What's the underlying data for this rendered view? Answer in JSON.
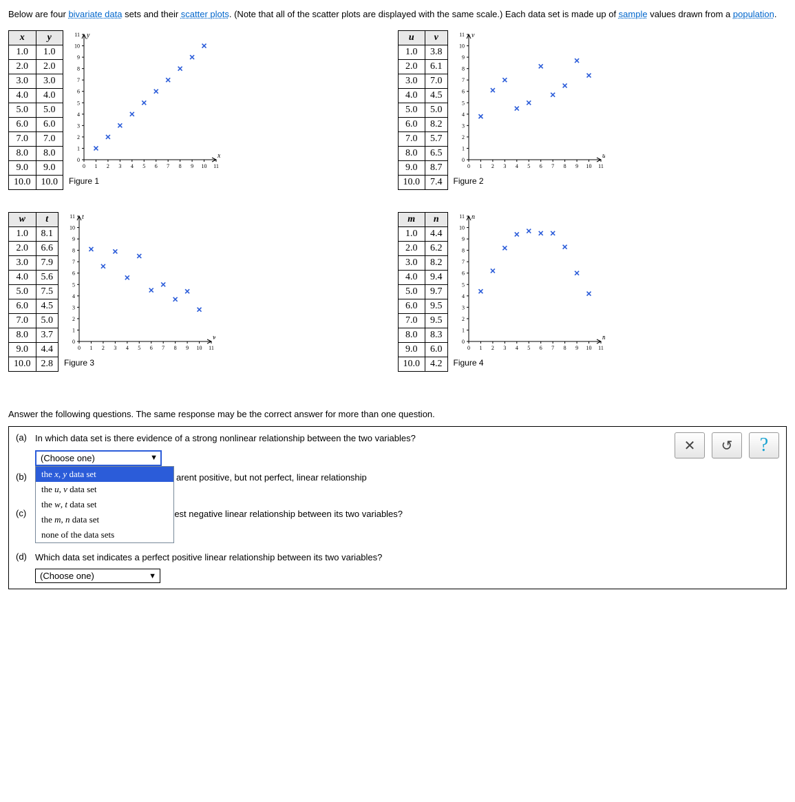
{
  "intro": {
    "pre": "Below are four ",
    "t1": "bivariate data",
    "mid1": " sets and their ",
    "t2": "scatter plots",
    "mid2": ". (Note that all of the scatter plots are displayed with the same scale.) Each data set is made up of ",
    "t3": "sample",
    "mid3": " values drawn from a ",
    "t4": "population",
    "post": "."
  },
  "axis": {
    "min": 0,
    "max": 11,
    "ticks": [
      0,
      1,
      2,
      3,
      4,
      5,
      6,
      7,
      8,
      9,
      10,
      11
    ]
  },
  "datasets": [
    {
      "id": "xy",
      "cols": [
        "x",
        "y"
      ],
      "caption": "Figure 1",
      "xAxis": "x",
      "yAxis": "y",
      "rows": [
        [
          "1.0",
          "1.0"
        ],
        [
          "2.0",
          "2.0"
        ],
        [
          "3.0",
          "3.0"
        ],
        [
          "4.0",
          "4.0"
        ],
        [
          "5.0",
          "5.0"
        ],
        [
          "6.0",
          "6.0"
        ],
        [
          "7.0",
          "7.0"
        ],
        [
          "8.0",
          "8.0"
        ],
        [
          "9.0",
          "9.0"
        ],
        [
          "10.0",
          "10.0"
        ]
      ]
    },
    {
      "id": "uv",
      "cols": [
        "u",
        "v"
      ],
      "caption": "Figure 2",
      "xAxis": "u",
      "yAxis": "v",
      "rows": [
        [
          "1.0",
          "3.8"
        ],
        [
          "2.0",
          "6.1"
        ],
        [
          "3.0",
          "7.0"
        ],
        [
          "4.0",
          "4.5"
        ],
        [
          "5.0",
          "5.0"
        ],
        [
          "6.0",
          "8.2"
        ],
        [
          "7.0",
          "5.7"
        ],
        [
          "8.0",
          "6.5"
        ],
        [
          "9.0",
          "8.7"
        ],
        [
          "10.0",
          "7.4"
        ]
      ]
    },
    {
      "id": "wt",
      "cols": [
        "w",
        "t"
      ],
      "caption": "Figure 3",
      "xAxis": "w",
      "yAxis": "t",
      "rows": [
        [
          "1.0",
          "8.1"
        ],
        [
          "2.0",
          "6.6"
        ],
        [
          "3.0",
          "7.9"
        ],
        [
          "4.0",
          "5.6"
        ],
        [
          "5.0",
          "7.5"
        ],
        [
          "6.0",
          "4.5"
        ],
        [
          "7.0",
          "5.0"
        ],
        [
          "8.0",
          "3.7"
        ],
        [
          "9.0",
          "4.4"
        ],
        [
          "10.0",
          "2.8"
        ]
      ]
    },
    {
      "id": "mn",
      "cols": [
        "m",
        "n"
      ],
      "caption": "Figure 4",
      "xAxis": "m",
      "yAxis": "n",
      "rows": [
        [
          "1.0",
          "4.4"
        ],
        [
          "2.0",
          "6.2"
        ],
        [
          "3.0",
          "8.2"
        ],
        [
          "4.0",
          "9.4"
        ],
        [
          "5.0",
          "9.7"
        ],
        [
          "6.0",
          "9.5"
        ],
        [
          "7.0",
          "9.5"
        ],
        [
          "8.0",
          "8.3"
        ],
        [
          "9.0",
          "6.0"
        ],
        [
          "10.0",
          "4.2"
        ]
      ]
    }
  ],
  "chart_data": [
    {
      "type": "scatter",
      "title": "Figure 1",
      "xlabel": "x",
      "ylabel": "y",
      "xlim": [
        0,
        11
      ],
      "ylim": [
        0,
        11
      ],
      "x": [
        1,
        2,
        3,
        4,
        5,
        6,
        7,
        8,
        9,
        10
      ],
      "y": [
        1,
        2,
        3,
        4,
        5,
        6,
        7,
        8,
        9,
        10
      ]
    },
    {
      "type": "scatter",
      "title": "Figure 2",
      "xlabel": "u",
      "ylabel": "v",
      "xlim": [
        0,
        11
      ],
      "ylim": [
        0,
        11
      ],
      "x": [
        1,
        2,
        3,
        4,
        5,
        6,
        7,
        8,
        9,
        10
      ],
      "y": [
        3.8,
        6.1,
        7.0,
        4.5,
        5.0,
        8.2,
        5.7,
        6.5,
        8.7,
        7.4
      ]
    },
    {
      "type": "scatter",
      "title": "Figure 3",
      "xlabel": "w",
      "ylabel": "t",
      "xlim": [
        0,
        11
      ],
      "ylim": [
        0,
        11
      ],
      "x": [
        1,
        2,
        3,
        4,
        5,
        6,
        7,
        8,
        9,
        10
      ],
      "y": [
        8.1,
        6.6,
        7.9,
        5.6,
        7.5,
        4.5,
        5.0,
        3.7,
        4.4,
        2.8
      ]
    },
    {
      "type": "scatter",
      "title": "Figure 4",
      "xlabel": "m",
      "ylabel": "n",
      "xlim": [
        0,
        11
      ],
      "ylim": [
        0,
        11
      ],
      "x": [
        1,
        2,
        3,
        4,
        5,
        6,
        7,
        8,
        9,
        10
      ],
      "y": [
        4.4,
        6.2,
        8.2,
        9.4,
        9.7,
        9.5,
        9.5,
        8.3,
        6.0,
        4.2
      ]
    }
  ],
  "afterq": "Answer the following questions. The same response may be the correct answer for more than one question.",
  "questions": {
    "a": {
      "label": "(a)",
      "text": "In which data set is there evidence of a strong nonlinear relationship between the two variables?"
    },
    "b": {
      "label": "(b)",
      "text_before": "",
      "partial_visible": "arent positive, but not perfect, linear relationship"
    },
    "c": {
      "label": "(c)",
      "text": "Which data set indicates the strongest negative linear relationship between its two variables?"
    },
    "d": {
      "label": "(d)",
      "text": "Which data set indicates a perfect positive linear relationship between its two variables?"
    }
  },
  "select": {
    "placeholder": "(Choose one)",
    "options": [
      {
        "text": "the x, y data set",
        "italic_pairs": true,
        "hot": true
      },
      {
        "text": "the u, v data set",
        "italic_pairs": true
      },
      {
        "text": "the w, t data set",
        "italic_pairs": true
      },
      {
        "text": "the m, n data set",
        "italic_pairs": true
      },
      {
        "text": "none of the data sets",
        "italic_pairs": false
      }
    ]
  },
  "toolbar": {
    "clear": "✕",
    "reset": "↺",
    "help": "?"
  }
}
